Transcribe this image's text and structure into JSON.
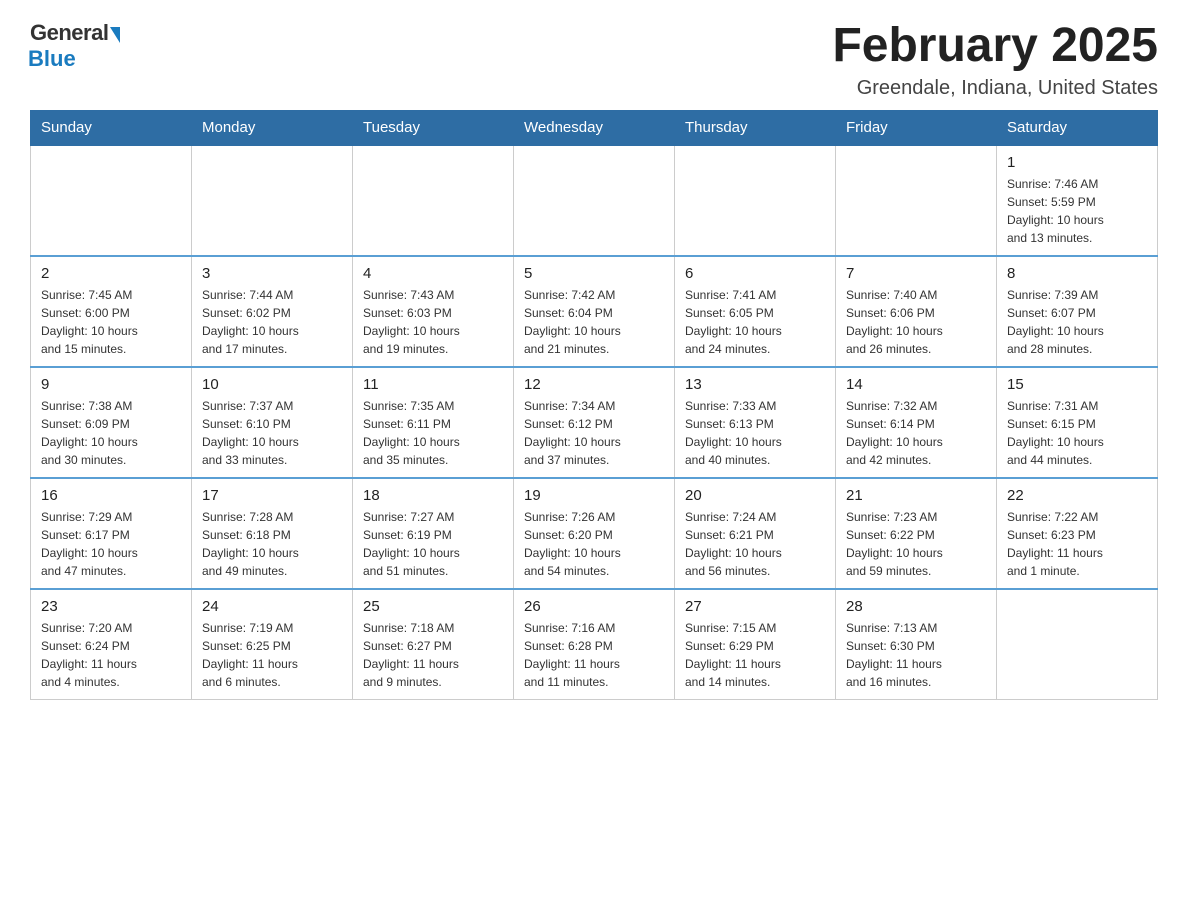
{
  "header": {
    "logo_general": "General",
    "logo_blue": "Blue",
    "month_title": "February 2025",
    "location": "Greendale, Indiana, United States"
  },
  "weekdays": [
    "Sunday",
    "Monday",
    "Tuesday",
    "Wednesday",
    "Thursday",
    "Friday",
    "Saturday"
  ],
  "weeks": [
    [
      {
        "day": "",
        "info": ""
      },
      {
        "day": "",
        "info": ""
      },
      {
        "day": "",
        "info": ""
      },
      {
        "day": "",
        "info": ""
      },
      {
        "day": "",
        "info": ""
      },
      {
        "day": "",
        "info": ""
      },
      {
        "day": "1",
        "info": "Sunrise: 7:46 AM\nSunset: 5:59 PM\nDaylight: 10 hours\nand 13 minutes."
      }
    ],
    [
      {
        "day": "2",
        "info": "Sunrise: 7:45 AM\nSunset: 6:00 PM\nDaylight: 10 hours\nand 15 minutes."
      },
      {
        "day": "3",
        "info": "Sunrise: 7:44 AM\nSunset: 6:02 PM\nDaylight: 10 hours\nand 17 minutes."
      },
      {
        "day": "4",
        "info": "Sunrise: 7:43 AM\nSunset: 6:03 PM\nDaylight: 10 hours\nand 19 minutes."
      },
      {
        "day": "5",
        "info": "Sunrise: 7:42 AM\nSunset: 6:04 PM\nDaylight: 10 hours\nand 21 minutes."
      },
      {
        "day": "6",
        "info": "Sunrise: 7:41 AM\nSunset: 6:05 PM\nDaylight: 10 hours\nand 24 minutes."
      },
      {
        "day": "7",
        "info": "Sunrise: 7:40 AM\nSunset: 6:06 PM\nDaylight: 10 hours\nand 26 minutes."
      },
      {
        "day": "8",
        "info": "Sunrise: 7:39 AM\nSunset: 6:07 PM\nDaylight: 10 hours\nand 28 minutes."
      }
    ],
    [
      {
        "day": "9",
        "info": "Sunrise: 7:38 AM\nSunset: 6:09 PM\nDaylight: 10 hours\nand 30 minutes."
      },
      {
        "day": "10",
        "info": "Sunrise: 7:37 AM\nSunset: 6:10 PM\nDaylight: 10 hours\nand 33 minutes."
      },
      {
        "day": "11",
        "info": "Sunrise: 7:35 AM\nSunset: 6:11 PM\nDaylight: 10 hours\nand 35 minutes."
      },
      {
        "day": "12",
        "info": "Sunrise: 7:34 AM\nSunset: 6:12 PM\nDaylight: 10 hours\nand 37 minutes."
      },
      {
        "day": "13",
        "info": "Sunrise: 7:33 AM\nSunset: 6:13 PM\nDaylight: 10 hours\nand 40 minutes."
      },
      {
        "day": "14",
        "info": "Sunrise: 7:32 AM\nSunset: 6:14 PM\nDaylight: 10 hours\nand 42 minutes."
      },
      {
        "day": "15",
        "info": "Sunrise: 7:31 AM\nSunset: 6:15 PM\nDaylight: 10 hours\nand 44 minutes."
      }
    ],
    [
      {
        "day": "16",
        "info": "Sunrise: 7:29 AM\nSunset: 6:17 PM\nDaylight: 10 hours\nand 47 minutes."
      },
      {
        "day": "17",
        "info": "Sunrise: 7:28 AM\nSunset: 6:18 PM\nDaylight: 10 hours\nand 49 minutes."
      },
      {
        "day": "18",
        "info": "Sunrise: 7:27 AM\nSunset: 6:19 PM\nDaylight: 10 hours\nand 51 minutes."
      },
      {
        "day": "19",
        "info": "Sunrise: 7:26 AM\nSunset: 6:20 PM\nDaylight: 10 hours\nand 54 minutes."
      },
      {
        "day": "20",
        "info": "Sunrise: 7:24 AM\nSunset: 6:21 PM\nDaylight: 10 hours\nand 56 minutes."
      },
      {
        "day": "21",
        "info": "Sunrise: 7:23 AM\nSunset: 6:22 PM\nDaylight: 10 hours\nand 59 minutes."
      },
      {
        "day": "22",
        "info": "Sunrise: 7:22 AM\nSunset: 6:23 PM\nDaylight: 11 hours\nand 1 minute."
      }
    ],
    [
      {
        "day": "23",
        "info": "Sunrise: 7:20 AM\nSunset: 6:24 PM\nDaylight: 11 hours\nand 4 minutes."
      },
      {
        "day": "24",
        "info": "Sunrise: 7:19 AM\nSunset: 6:25 PM\nDaylight: 11 hours\nand 6 minutes."
      },
      {
        "day": "25",
        "info": "Sunrise: 7:18 AM\nSunset: 6:27 PM\nDaylight: 11 hours\nand 9 minutes."
      },
      {
        "day": "26",
        "info": "Sunrise: 7:16 AM\nSunset: 6:28 PM\nDaylight: 11 hours\nand 11 minutes."
      },
      {
        "day": "27",
        "info": "Sunrise: 7:15 AM\nSunset: 6:29 PM\nDaylight: 11 hours\nand 14 minutes."
      },
      {
        "day": "28",
        "info": "Sunrise: 7:13 AM\nSunset: 6:30 PM\nDaylight: 11 hours\nand 16 minutes."
      },
      {
        "day": "",
        "info": ""
      }
    ]
  ]
}
